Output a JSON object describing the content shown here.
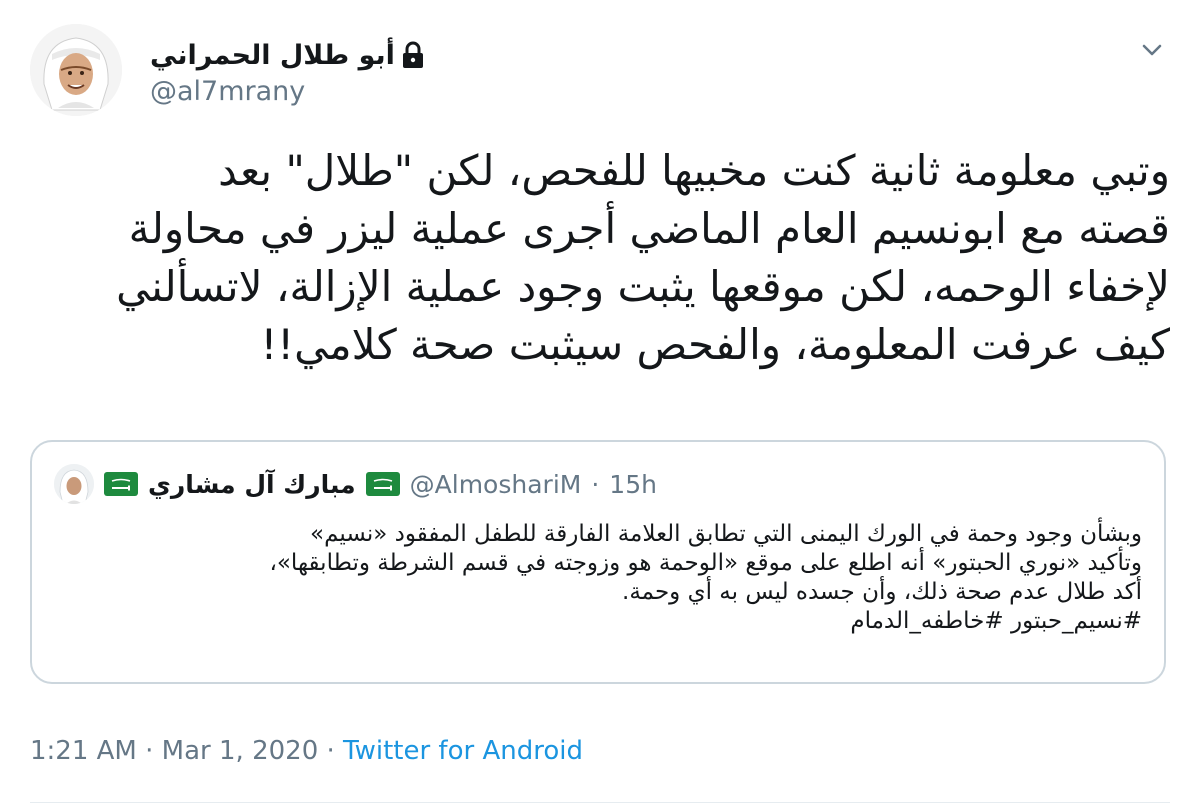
{
  "author": {
    "display_name": "أبو طلال الحمراني",
    "handle": "@al7mrany",
    "protected": true,
    "avatar_icon": "profile-photo-man-ghutra"
  },
  "tweet": {
    "lines": [
      "وتبي معلومة ثانية كنت مخبيها للفحص، لكن \"طلال\" بعد",
      "قصته مع ابونسيم العام الماضي أجرى عملية ليزر في محاولة",
      "لإخفاء الوحمه، لكن موقعها يثبت وجود عملية الإزالة، لاتسألني",
      "كيف عرفت المعلومة، والفحص سيثبت صحة كلامي!!"
    ]
  },
  "quoted_tweet": {
    "display_name": "مبارك آل مشاري",
    "handle": "@AlmoshariM",
    "separator": "·",
    "time": "15h",
    "flag_icon": "saudi-flag-icon",
    "lines": [
      "وبشأن وجود وحمة في الورك اليمنى التي تطابق العلامة الفارقة للطفل المفقود «نسيم»",
      "وتأكيد «نوري الحبتور» أنه اطلع على موقع «الوحمة هو وزوجته في قسم الشرطة وتطابقها»،",
      "أكد طلال عدم صحة ذلك، وأن جسده ليس به أي وحمة.",
      "#نسيم_حبتور #خاطفه_الدمام"
    ]
  },
  "footer": {
    "time": "1:21 AM",
    "sep1": "·",
    "date": "Mar 1, 2020",
    "sep2": "·",
    "source": "Twitter for Android"
  },
  "colors": {
    "text": "#14171a",
    "secondary": "#657786",
    "link": "#1b95e0",
    "border": "#ccd6dd"
  }
}
